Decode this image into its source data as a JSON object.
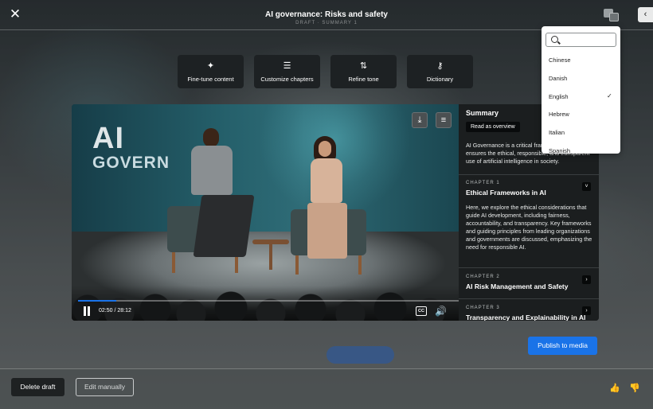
{
  "header": {
    "title": "AI governance: Risks and safety",
    "subtitle": "DRAFT · SUMMARY 1",
    "close_icon": "✕",
    "side_toggle_icon": "‹"
  },
  "toolbar": {
    "items": [
      {
        "label": "Fine-tune content",
        "icon": "✦"
      },
      {
        "label": "Customize chapters",
        "icon": "☰"
      },
      {
        "label": "Refine tone",
        "icon": "⇅"
      },
      {
        "label": "Dictionary",
        "icon": "⚷"
      }
    ]
  },
  "video": {
    "overlay_word_1": "AI",
    "overlay_word_2": "GOVERN",
    "time": "02:50 / 28:12",
    "progress": 0.1,
    "cc_label": "CC",
    "download_icon": "⤓",
    "transcript_icon": "≡",
    "volume_icon": "🔊"
  },
  "summary": {
    "heading": "Summary",
    "overview_badge": "Read as overview",
    "overview_text": "AI Governance is a critical framework that ensures the ethical, responsible, and transparent use of artificial intelligence in society.",
    "chapters": [
      {
        "label": "CHAPTER 1",
        "title": "Ethical Frameworks in AI",
        "toggle": "˅",
        "body": "Here, we explore the ethical considerations that guide AI development, including fairness, accountability, and transparency. Key frameworks and guiding principles from leading organizations and governments are discussed, emphasizing the need for responsible AI."
      },
      {
        "label": "CHAPTER 2",
        "title": "AI Risk Management and Safety",
        "toggle": "›"
      },
      {
        "label": "CHAPTER 3",
        "title": "Transparency and Explainability in AI",
        "toggle": "›"
      }
    ]
  },
  "language_dropdown": {
    "search_placeholder": "",
    "options": [
      "Chinese",
      "Danish",
      "English",
      "Hebrew",
      "Italian",
      "Spanish"
    ],
    "selected": "English",
    "check_icon": "✓"
  },
  "actions": {
    "publish_label": "Publish to media",
    "delete_label": "Delete draft",
    "edit_label": "Edit manually",
    "thumbs_up_icon": "👍",
    "thumbs_down_icon": "👎"
  }
}
